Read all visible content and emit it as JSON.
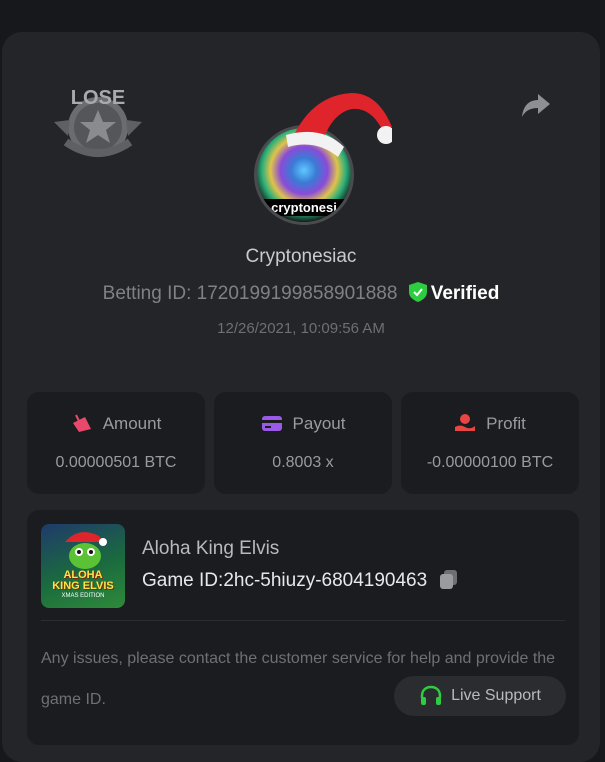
{
  "badge": {
    "text": "LOSE"
  },
  "user": {
    "name": "Cryptonesiac",
    "avatar_text": "cryptonesi",
    "betting_id_label": "Betting ID:",
    "betting_id": "1720199199858901888",
    "verified_label": "Verified",
    "timestamp": "12/26/2021, 10:09:56 AM"
  },
  "stats": {
    "amount": {
      "label": "Amount",
      "value": "0.00000501 BTC"
    },
    "payout": {
      "label": "Payout",
      "value": "0.8003 x"
    },
    "profit": {
      "label": "Profit",
      "value": "-0.00000100 BTC"
    }
  },
  "game": {
    "name": "Aloha King Elvis",
    "thumb_title_line1": "ALOHA",
    "thumb_title_line2": "KING ELVIS",
    "thumb_subtitle": "XMAS EDITION",
    "id_label": "Game ID:",
    "id": "2hc-5hiuzy-6804190463"
  },
  "notice": "Any issues, please contact the customer service for help and provide the game ID.",
  "support": {
    "label": "Live Support"
  },
  "colors": {
    "background": "#17181b",
    "card": "#242528",
    "verified_green": "#2ecc40",
    "amount_icon": "#e8496a",
    "payout_icon": "#9b59e8",
    "profit_icon": "#e84545",
    "support_icon": "#2ecc40"
  }
}
